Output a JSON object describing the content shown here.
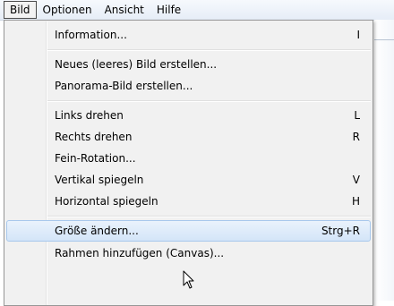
{
  "menubar": {
    "items": [
      {
        "label": "Bild"
      },
      {
        "label": "Optionen"
      },
      {
        "label": "Ansicht"
      },
      {
        "label": "Hilfe"
      }
    ]
  },
  "menu": {
    "items": [
      {
        "label": "Information...",
        "shortcut": "I"
      },
      {
        "label": "Neues (leeres) Bild erstellen...",
        "shortcut": ""
      },
      {
        "label": "Panorama-Bild erstellen...",
        "shortcut": ""
      },
      {
        "label": "Links drehen",
        "shortcut": "L"
      },
      {
        "label": "Rechts drehen",
        "shortcut": "R"
      },
      {
        "label": "Fein-Rotation...",
        "shortcut": ""
      },
      {
        "label": "Vertikal spiegeln",
        "shortcut": "V"
      },
      {
        "label": "Horizontal spiegeln",
        "shortcut": "H"
      },
      {
        "label": "Größe ändern...",
        "shortcut": "Strg+R"
      },
      {
        "label": "Rahmen hinzufügen (Canvas)...",
        "shortcut": ""
      }
    ]
  },
  "cursor": {
    "icon": "arrow-pointer-icon"
  }
}
